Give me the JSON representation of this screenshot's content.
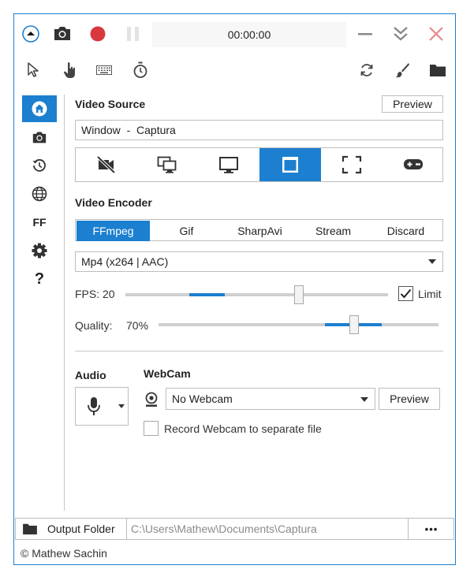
{
  "titlebar": {
    "timer": "00:00:00",
    "icons": [
      "collapse-icon",
      "camera-icon",
      "record-icon",
      "pause-icon",
      "minimize-icon",
      "minimize-to-tray-icon",
      "close-icon"
    ]
  },
  "toolbar": {
    "icons": [
      "cursor-icon",
      "click-icon",
      "keystrokes-icon",
      "timer-icon",
      "refresh-icon",
      "brush-icon",
      "folder-icon"
    ]
  },
  "sidebar": {
    "items": [
      {
        "name": "home-icon",
        "active": true
      },
      {
        "name": "camera-icon",
        "active": false
      },
      {
        "name": "history-icon",
        "active": false
      },
      {
        "name": "language-icon",
        "active": false
      },
      {
        "name": "ffmpeg-icon",
        "label": "FF",
        "active": false
      },
      {
        "name": "settings-icon",
        "active": false
      },
      {
        "name": "help-icon",
        "label": "?",
        "active": false
      }
    ]
  },
  "video_source": {
    "heading": "Video Source",
    "preview_label": "Preview",
    "selected": "Window  -  Captura",
    "sources": [
      {
        "name": "no-video-icon",
        "active": false
      },
      {
        "name": "multiple-screens-icon",
        "active": false
      },
      {
        "name": "screen-icon",
        "active": false
      },
      {
        "name": "window-icon",
        "active": true
      },
      {
        "name": "region-icon",
        "active": false
      },
      {
        "name": "gamepad-icon",
        "active": false
      }
    ]
  },
  "video_encoder": {
    "heading": "Video Encoder",
    "tabs": [
      {
        "label": "FFmpeg",
        "active": true
      },
      {
        "label": "Gif",
        "active": false
      },
      {
        "label": "SharpAvi",
        "active": false
      },
      {
        "label": "Stream",
        "active": false
      },
      {
        "label": "Discard",
        "active": false
      }
    ],
    "codec": "Mp4 (x264 | AAC)",
    "fps_label": "FPS:",
    "fps_value": "20",
    "fps_limit_label": "Limit",
    "fps_limit_checked": true,
    "quality_label": "Quality:",
    "quality_value": "70%",
    "fps_fraction": 0.66,
    "quality_fraction": 0.7
  },
  "audio": {
    "heading": "Audio"
  },
  "webcam": {
    "heading": "WebCam",
    "selected": "No Webcam",
    "preview_label": "Preview",
    "separate_file_label": "Record Webcam to separate file",
    "separate_file_checked": false
  },
  "footer": {
    "output_folder_label": "Output Folder",
    "output_path": "C:\\Users\\Mathew\\Documents\\Captura",
    "more_label": "•••",
    "copyright": "© Mathew Sachin"
  },
  "colors": {
    "accent": "#1c7fcf",
    "record": "#d9383f",
    "close": "#e8888b"
  }
}
